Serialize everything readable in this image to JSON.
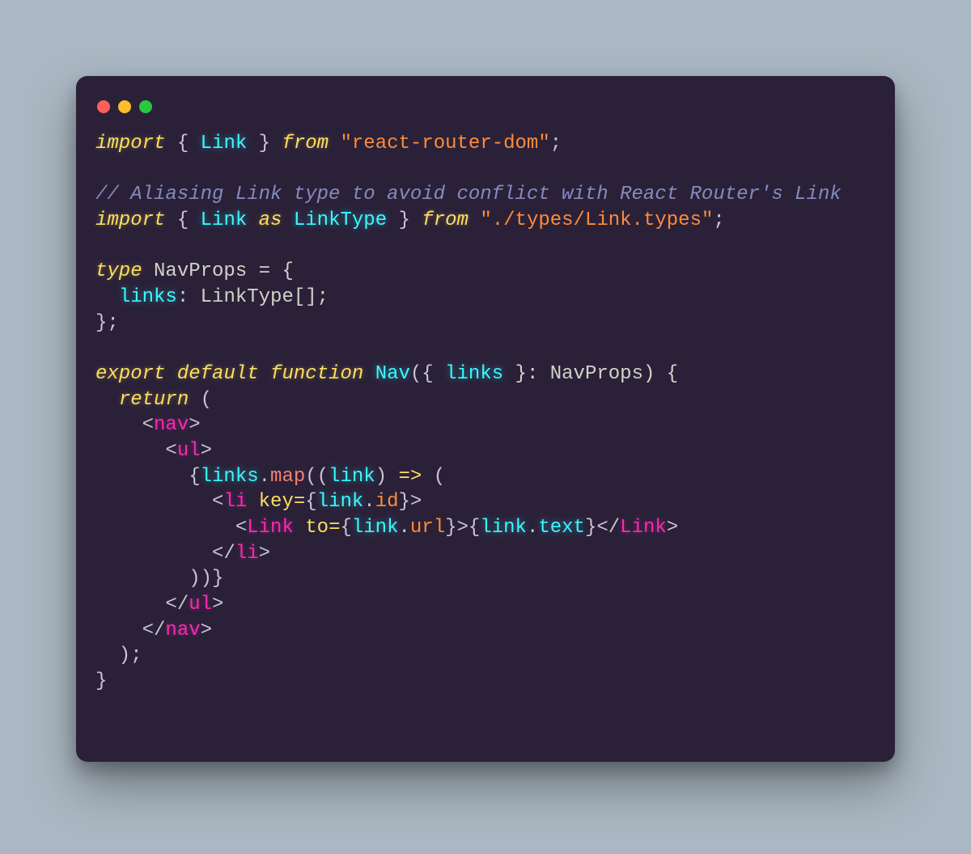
{
  "window": {
    "traffic_lights": [
      "close",
      "minimize",
      "zoom"
    ]
  },
  "code": {
    "l01_import": "import",
    "l01_braceL": " { ",
    "l01_Link": "Link",
    "l01_braceR": " } ",
    "l01_from": "from",
    "l01_sp": " ",
    "l01_str": "\"react-router-dom\"",
    "l01_semi": ";",
    "l03_comment": "// Aliasing Link type to avoid conflict with React Router's Link",
    "l04_import": "import",
    "l04_braceL": " { ",
    "l04_Link": "Link",
    "l04_sp1": " ",
    "l04_as": "as",
    "l04_sp2": " ",
    "l04_LinkType": "LinkType",
    "l04_braceR": " } ",
    "l04_from": "from",
    "l04_sp3": " ",
    "l04_str": "\"./types/Link.types\"",
    "l04_semi": ";",
    "l06_type": "type",
    "l06_rest": " NavProps = {",
    "l07_indent": "  ",
    "l07_links": "links",
    "l07_rest": ": LinkType[];",
    "l08": "};",
    "l10_export": "export",
    "l10_sp1": " ",
    "l10_default": "default",
    "l10_sp2": " ",
    "l10_function": "function",
    "l10_sp3": " ",
    "l10_Nav": "Nav",
    "l10_paren": "({ ",
    "l10_links": "links",
    "l10_rest": " }: NavProps) {",
    "l11_indent": "  ",
    "l11_return": "return",
    "l11_rest": " (",
    "l12_indent": "    ",
    "l12_lt": "<",
    "l12_nav": "nav",
    "l12_gt": ">",
    "l13_indent": "      ",
    "l13_lt": "<",
    "l13_ul": "ul",
    "l13_gt": ">",
    "l14_indent": "        ",
    "l14_braceL": "{",
    "l14_links": "links",
    "l14_dot": ".",
    "l14_map": "map",
    "l14_open": "((",
    "l14_link": "link",
    "l14_close": ") ",
    "l14_arrow": "=>",
    "l14_tail": " (",
    "l15_indent": "          ",
    "l15_lt": "<",
    "l15_li": "li",
    "l15_sp": " ",
    "l15_key": "key",
    "l15_eq": "=",
    "l15_braceL": "{",
    "l15_link": "link",
    "l15_dot": ".",
    "l15_id": "id",
    "l15_braceR": "}",
    "l15_gt": ">",
    "l16_indent": "            ",
    "l16_lt": "<",
    "l16_Link": "Link",
    "l16_sp": " ",
    "l16_to": "to",
    "l16_eq": "=",
    "l16_braceL": "{",
    "l16_link": "link",
    "l16_dot": ".",
    "l16_url": "url",
    "l16_braceR": "}",
    "l16_gt": ">",
    "l16_braceL2": "{",
    "l16_link2": "link",
    "l16_dot2": ".",
    "l16_text": "text",
    "l16_braceR2": "}",
    "l16_ltc": "</",
    "l16_Linkc": "Link",
    "l16_gtc": ">",
    "l17_indent": "          ",
    "l17_ltc": "</",
    "l17_li": "li",
    "l17_gt": ">",
    "l18_indent": "        ",
    "l18": "))}",
    "l19_indent": "      ",
    "l19_ltc": "</",
    "l19_ul": "ul",
    "l19_gt": ">",
    "l20_indent": "    ",
    "l20_ltc": "</",
    "l20_nav": "nav",
    "l20_gt": ">",
    "l21": "  );",
    "l22": "}"
  }
}
